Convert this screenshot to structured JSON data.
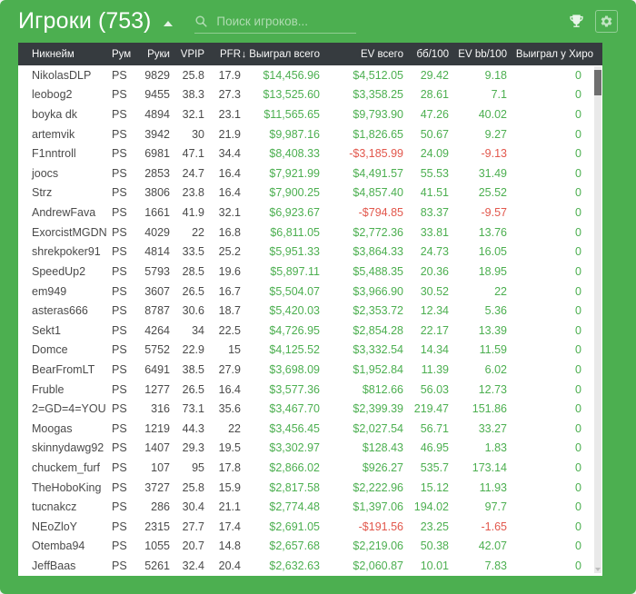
{
  "colors": {
    "app_green": "#4caf50",
    "table_header_bg": "#363b3f",
    "positive_value": "#4caf50",
    "negative_value": "#e2574c",
    "row_text": "#4a4a4a"
  },
  "topbar": {
    "title": "Игроки",
    "count_display": "(753)",
    "search_placeholder": "Поиск игроков..."
  },
  "table": {
    "sort": {
      "column": "won_total",
      "direction": "desc",
      "glyph": "↓"
    },
    "columns": [
      {
        "key": "nickname",
        "label": "Никнейм",
        "align": "left",
        "colored": false
      },
      {
        "key": "room",
        "label": "Рум",
        "align": "left",
        "colored": false
      },
      {
        "key": "hands",
        "label": "Руки",
        "align": "right",
        "colored": false
      },
      {
        "key": "vpip",
        "label": "VPIP",
        "align": "right",
        "colored": false
      },
      {
        "key": "pfr",
        "label": "PFR",
        "align": "right",
        "colored": false
      },
      {
        "key": "won_total",
        "label": "Выиграл всего",
        "align": "right",
        "colored": true,
        "sorted": true
      },
      {
        "key": "ev_total",
        "label": "EV всего",
        "align": "right",
        "colored": true
      },
      {
        "key": "bb100",
        "label": "бб/100",
        "align": "right",
        "colored": true
      },
      {
        "key": "ev_bb100",
        "label": "EV bb/100",
        "align": "right",
        "colored": true
      },
      {
        "key": "won_vs_hero",
        "label": "Выиграл у Хиро",
        "align": "right",
        "colored": true
      }
    ],
    "rows": [
      {
        "nickname": "NikolasDLP",
        "room": "PS",
        "hands": "9829",
        "vpip": "25.8",
        "pfr": "17.9",
        "won_total": "$14,456.96",
        "ev_total": "$4,512.05",
        "bb100": "29.42",
        "ev_bb100": "9.18",
        "won_vs_hero": "0"
      },
      {
        "nickname": "leobog2",
        "room": "PS",
        "hands": "9455",
        "vpip": "38.3",
        "pfr": "27.3",
        "won_total": "$13,525.60",
        "ev_total": "$3,358.25",
        "bb100": "28.61",
        "ev_bb100": "7.1",
        "won_vs_hero": "0"
      },
      {
        "nickname": "boyka dk",
        "room": "PS",
        "hands": "4894",
        "vpip": "32.1",
        "pfr": "23.1",
        "won_total": "$11,565.65",
        "ev_total": "$9,793.90",
        "bb100": "47.26",
        "ev_bb100": "40.02",
        "won_vs_hero": "0"
      },
      {
        "nickname": "artemvik",
        "room": "PS",
        "hands": "3942",
        "vpip": "30",
        "pfr": "21.9",
        "won_total": "$9,987.16",
        "ev_total": "$1,826.65",
        "bb100": "50.67",
        "ev_bb100": "9.27",
        "won_vs_hero": "0"
      },
      {
        "nickname": "F1nntroll",
        "room": "PS",
        "hands": "6981",
        "vpip": "47.1",
        "pfr": "34.4",
        "won_total": "$8,408.33",
        "ev_total": "-$3,185.99",
        "bb100": "24.09",
        "ev_bb100": "-9.13",
        "won_vs_hero": "0"
      },
      {
        "nickname": "joocs",
        "room": "PS",
        "hands": "2853",
        "vpip": "24.7",
        "pfr": "16.4",
        "won_total": "$7,921.99",
        "ev_total": "$4,491.57",
        "bb100": "55.53",
        "ev_bb100": "31.49",
        "won_vs_hero": "0"
      },
      {
        "nickname": "Strz",
        "room": "PS",
        "hands": "3806",
        "vpip": "23.8",
        "pfr": "16.4",
        "won_total": "$7,900.25",
        "ev_total": "$4,857.40",
        "bb100": "41.51",
        "ev_bb100": "25.52",
        "won_vs_hero": "0"
      },
      {
        "nickname": "AndrewFava",
        "room": "PS",
        "hands": "1661",
        "vpip": "41.9",
        "pfr": "32.1",
        "won_total": "$6,923.67",
        "ev_total": "-$794.85",
        "bb100": "83.37",
        "ev_bb100": "-9.57",
        "won_vs_hero": "0"
      },
      {
        "nickname": "ExorcistMGDN",
        "room": "PS",
        "hands": "4029",
        "vpip": "22",
        "pfr": "16.8",
        "won_total": "$6,811.05",
        "ev_total": "$2,772.36",
        "bb100": "33.81",
        "ev_bb100": "13.76",
        "won_vs_hero": "0"
      },
      {
        "nickname": "shrekpoker91",
        "room": "PS",
        "hands": "4814",
        "vpip": "33.5",
        "pfr": "25.2",
        "won_total": "$5,951.33",
        "ev_total": "$3,864.33",
        "bb100": "24.73",
        "ev_bb100": "16.05",
        "won_vs_hero": "0"
      },
      {
        "nickname": "SpeedUp2",
        "room": "PS",
        "hands": "5793",
        "vpip": "28.5",
        "pfr": "19.6",
        "won_total": "$5,897.11",
        "ev_total": "$5,488.35",
        "bb100": "20.36",
        "ev_bb100": "18.95",
        "won_vs_hero": "0"
      },
      {
        "nickname": "em949",
        "room": "PS",
        "hands": "3607",
        "vpip": "26.5",
        "pfr": "16.7",
        "won_total": "$5,504.07",
        "ev_total": "$3,966.90",
        "bb100": "30.52",
        "ev_bb100": "22",
        "won_vs_hero": "0"
      },
      {
        "nickname": "asteras666",
        "room": "PS",
        "hands": "8787",
        "vpip": "30.6",
        "pfr": "18.7",
        "won_total": "$5,420.03",
        "ev_total": "$2,353.72",
        "bb100": "12.34",
        "ev_bb100": "5.36",
        "won_vs_hero": "0"
      },
      {
        "nickname": "Sekt1",
        "room": "PS",
        "hands": "4264",
        "vpip": "34",
        "pfr": "22.5",
        "won_total": "$4,726.95",
        "ev_total": "$2,854.28",
        "bb100": "22.17",
        "ev_bb100": "13.39",
        "won_vs_hero": "0"
      },
      {
        "nickname": "Domce",
        "room": "PS",
        "hands": "5752",
        "vpip": "22.9",
        "pfr": "15",
        "won_total": "$4,125.52",
        "ev_total": "$3,332.54",
        "bb100": "14.34",
        "ev_bb100": "11.59",
        "won_vs_hero": "0"
      },
      {
        "nickname": "BearFromLT",
        "room": "PS",
        "hands": "6491",
        "vpip": "38.5",
        "pfr": "27.9",
        "won_total": "$3,698.09",
        "ev_total": "$1,952.84",
        "bb100": "11.39",
        "ev_bb100": "6.02",
        "won_vs_hero": "0"
      },
      {
        "nickname": "Fruble",
        "room": "PS",
        "hands": "1277",
        "vpip": "26.5",
        "pfr": "16.4",
        "won_total": "$3,577.36",
        "ev_total": "$812.66",
        "bb100": "56.03",
        "ev_bb100": "12.73",
        "won_vs_hero": "0"
      },
      {
        "nickname": "2=GD=4=YOU",
        "room": "PS",
        "hands": "316",
        "vpip": "73.1",
        "pfr": "35.6",
        "won_total": "$3,467.70",
        "ev_total": "$2,399.39",
        "bb100": "219.47",
        "ev_bb100": "151.86",
        "won_vs_hero": "0"
      },
      {
        "nickname": "Moogas",
        "room": "PS",
        "hands": "1219",
        "vpip": "44.3",
        "pfr": "22",
        "won_total": "$3,456.45",
        "ev_total": "$2,027.54",
        "bb100": "56.71",
        "ev_bb100": "33.27",
        "won_vs_hero": "0"
      },
      {
        "nickname": "skinnydawg92",
        "room": "PS",
        "hands": "1407",
        "vpip": "29.3",
        "pfr": "19.5",
        "won_total": "$3,302.97",
        "ev_total": "$128.43",
        "bb100": "46.95",
        "ev_bb100": "1.83",
        "won_vs_hero": "0"
      },
      {
        "nickname": "chuckem_furf",
        "room": "PS",
        "hands": "107",
        "vpip": "95",
        "pfr": "17.8",
        "won_total": "$2,866.02",
        "ev_total": "$926.27",
        "bb100": "535.7",
        "ev_bb100": "173.14",
        "won_vs_hero": "0"
      },
      {
        "nickname": "TheHoboKing",
        "room": "PS",
        "hands": "3727",
        "vpip": "25.8",
        "pfr": "15.9",
        "won_total": "$2,817.58",
        "ev_total": "$2,222.96",
        "bb100": "15.12",
        "ev_bb100": "11.93",
        "won_vs_hero": "0"
      },
      {
        "nickname": "tucnakcz",
        "room": "PS",
        "hands": "286",
        "vpip": "30.4",
        "pfr": "21.1",
        "won_total": "$2,774.48",
        "ev_total": "$1,397.06",
        "bb100": "194.02",
        "ev_bb100": "97.7",
        "won_vs_hero": "0"
      },
      {
        "nickname": "NEoZloY",
        "room": "PS",
        "hands": "2315",
        "vpip": "27.7",
        "pfr": "17.4",
        "won_total": "$2,691.05",
        "ev_total": "-$191.56",
        "bb100": "23.25",
        "ev_bb100": "-1.65",
        "won_vs_hero": "0"
      },
      {
        "nickname": "Otemba94",
        "room": "PS",
        "hands": "1055",
        "vpip": "20.7",
        "pfr": "14.8",
        "won_total": "$2,657.68",
        "ev_total": "$2,219.06",
        "bb100": "50.38",
        "ev_bb100": "42.07",
        "won_vs_hero": "0"
      },
      {
        "nickname": "JeffBaas",
        "room": "PS",
        "hands": "5261",
        "vpip": "32.4",
        "pfr": "20.4",
        "won_total": "$2,632.63",
        "ev_total": "$2,060.87",
        "bb100": "10.01",
        "ev_bb100": "7.83",
        "won_vs_hero": "0"
      }
    ]
  }
}
